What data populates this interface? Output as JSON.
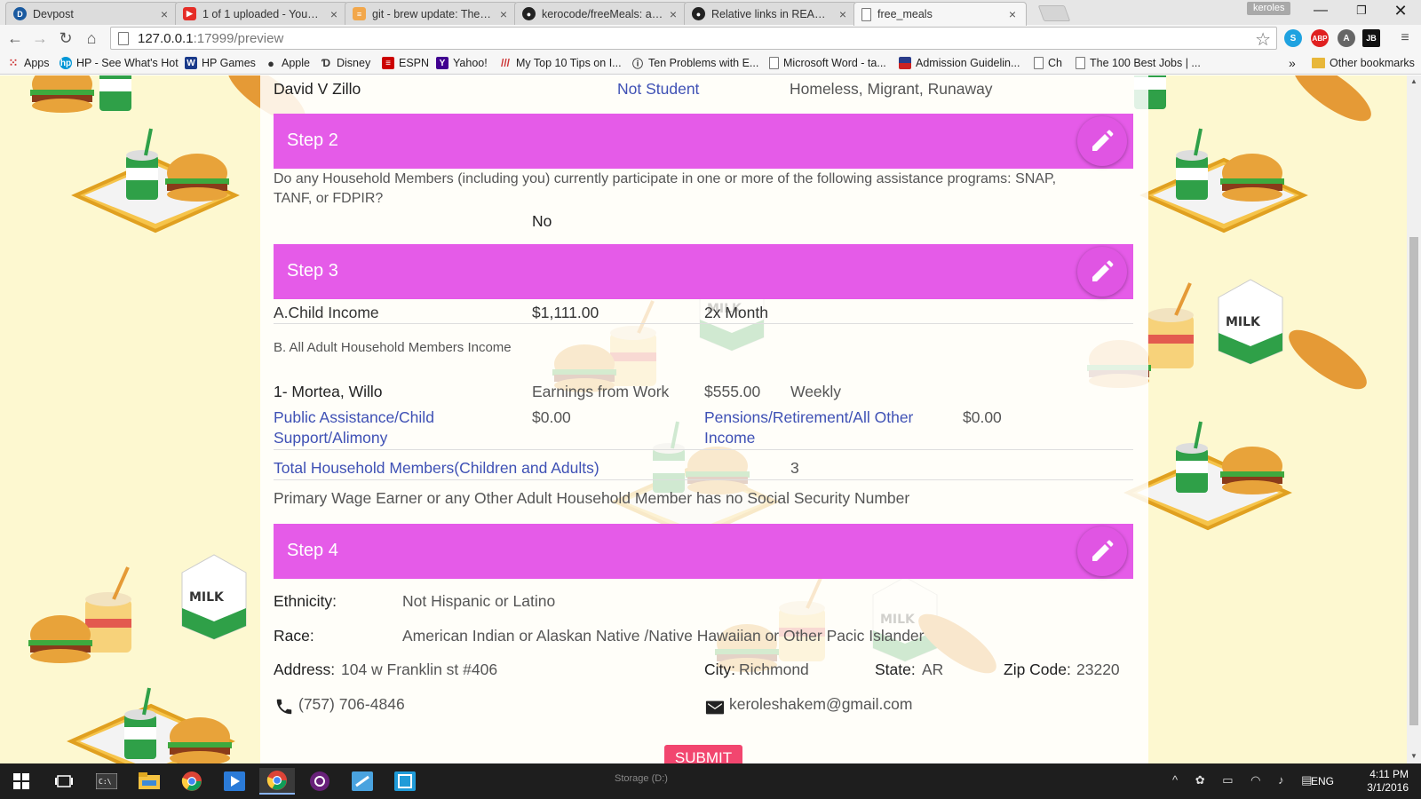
{
  "browser": {
    "tabs": [
      {
        "title": "Devpost",
        "favicon_color": "#1a5aa0",
        "favicon_glyph": "D"
      },
      {
        "title": "1 of 1 uploaded - YouTube",
        "favicon_color": "#e52d27",
        "favicon_glyph": "▶"
      },
      {
        "title": "git - brew update: The follo",
        "favicon_color": "#f2a74b",
        "favicon_glyph": "≡"
      },
      {
        "title": "kerocode/freeMeals: a mo",
        "favicon_color": "#222222",
        "favicon_glyph": "●"
      },
      {
        "title": "Relative links in READMEs",
        "favicon_color": "#222222",
        "favicon_glyph": "●"
      },
      {
        "title": "free_meals",
        "favicon_color": "#ffffff",
        "favicon_glyph": ""
      }
    ],
    "profile_name": "keroles",
    "url": "127.0.0.1:17999/preview",
    "url_host": "127.0.0.1",
    "url_rest": ":17999/preview",
    "bookmarks": [
      {
        "label": "Apps",
        "icon": "apps-icon"
      },
      {
        "label": "HP - See What's Hot",
        "icon": "hp-icon"
      },
      {
        "label": "HP Games",
        "icon": "hp-games-icon"
      },
      {
        "label": "Apple",
        "icon": "apple-icon"
      },
      {
        "label": "Disney",
        "icon": "disney-icon"
      },
      {
        "label": "ESPN",
        "icon": "espn-icon"
      },
      {
        "label": "Yahoo!",
        "icon": "yahoo-icon"
      },
      {
        "label": "My Top 10 Tips on I...",
        "icon": "tips-icon"
      },
      {
        "label": "Ten Problems with E...",
        "icon": "info-icon"
      },
      {
        "label": "Microsoft Word - ta...",
        "icon": "document-icon"
      },
      {
        "label": "Admission Guidelin...",
        "icon": "flag-icon"
      },
      {
        "label": "Ch",
        "icon": "document-icon"
      },
      {
        "label": "The 100 Best Jobs | ...",
        "icon": "document-icon"
      }
    ],
    "bookmarks_overflow": "»",
    "other_bookmarks": "Other bookmarks"
  },
  "form": {
    "student_row": {
      "name": "David V Zillo",
      "status": "Not Student",
      "category": "Homeless, Migrant, Runaway"
    },
    "step2": {
      "title": "Step 2",
      "question_line1": "Do any Household Members (including you) currently participate in one or more of the following assistance programs: SNAP,",
      "question_line2": "TANF, or FDPIR?",
      "answer": "No"
    },
    "step3": {
      "title": "Step 3",
      "child_income_label": "A.Child Income",
      "child_income_amount": "$1,111.00",
      "child_income_freq": "2x Month",
      "adult_section_label": "B. All Adult Household Members Income",
      "adult": {
        "name": "1- Mortea, Willo",
        "earnings_label": "Earnings from Work",
        "earnings_amount": "$555.00",
        "earnings_freq": "Weekly",
        "assist_label_line1": "Public Assistance/Child",
        "assist_label_line2": "Support/Alimony",
        "assist_amount": "$0.00",
        "pension_label_line1": "Pensions/Retirement/All Other",
        "pension_label_line2": "Income",
        "pension_amount": "$0.00"
      },
      "total_label": "Total Household Members(Children and Adults)",
      "total_value": "3",
      "ssn_note": "Primary Wage Earner or any Other Adult Household Member has no Social Security Number"
    },
    "step4": {
      "title": "Step 4",
      "ethnicity_label": "Ethnicity:",
      "ethnicity_value": "Not Hispanic or Latino",
      "race_label": "Race:",
      "race_value": "American Indian or Alaskan Native /Native Hawaiian or Other Pacic Islander",
      "address_label": "Address:",
      "address_value": "104 w Franklin st #406",
      "city_label": "City:",
      "city_value": "Richmond",
      "state_label": "State:",
      "state_value": "AR",
      "zip_label": "Zip Code:",
      "zip_value": "23220",
      "phone": "(757) 706-4846",
      "email": "keroleshakem@gmail.com"
    },
    "submit_label": "SUBMIT"
  },
  "taskbar": {
    "storage_label": "Storage (D:)",
    "language": "ENG",
    "time": "4:11 PM",
    "date": "3/1/2016"
  },
  "colors": {
    "step_bar": "#e55be8",
    "link": "#3f51b5",
    "submit": "#f2466f",
    "page_background": "#fdf8d0"
  }
}
